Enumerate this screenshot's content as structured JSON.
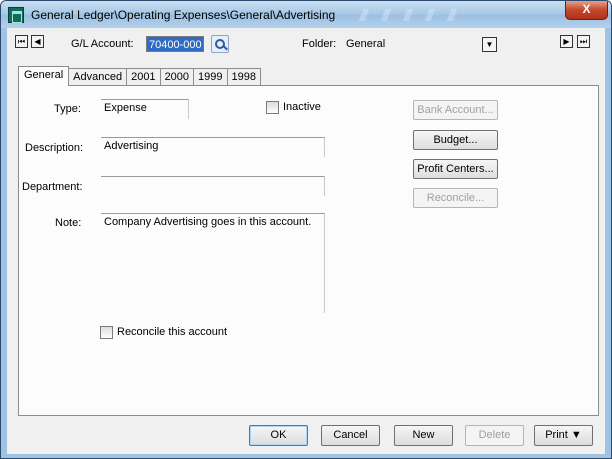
{
  "window": {
    "title": "General Ledger\\Operating Expenses\\General\\Advertising",
    "close_glyph": "X"
  },
  "header": {
    "gl_account_label": "G/L Account:",
    "gl_account_value": "70400-000",
    "folder_label": "Folder:",
    "folder_value": "General",
    "first_glyph": "⏮",
    "prev_glyph": "◀",
    "next_glyph": "▶",
    "last_glyph": "⏭",
    "dropdown_glyph": "▼"
  },
  "tabs": [
    {
      "label": "General"
    },
    {
      "label": "Advanced"
    },
    {
      "label": "2001"
    },
    {
      "label": "2000"
    },
    {
      "label": "1999"
    },
    {
      "label": "1998"
    }
  ],
  "general": {
    "type_label": "Type:",
    "type_value": "Expense",
    "inactive_label": "Inactive",
    "inactive_checked": false,
    "description_label": "Description:",
    "description_value": "Advertising",
    "department_label": "Department:",
    "department_value": "",
    "note_label": "Note:",
    "note_value": "Company Advertising goes in this account.",
    "reconcile_label": "Reconcile this account",
    "reconcile_checked": false
  },
  "side_buttons": {
    "bank_account": "Bank Account...",
    "budget": "Budget...",
    "profit_centers": "Profit Centers...",
    "reconcile": "Reconcile..."
  },
  "footer": {
    "ok": "OK",
    "cancel": "Cancel",
    "new": "New",
    "delete": "Delete",
    "print": "Print ▼"
  }
}
